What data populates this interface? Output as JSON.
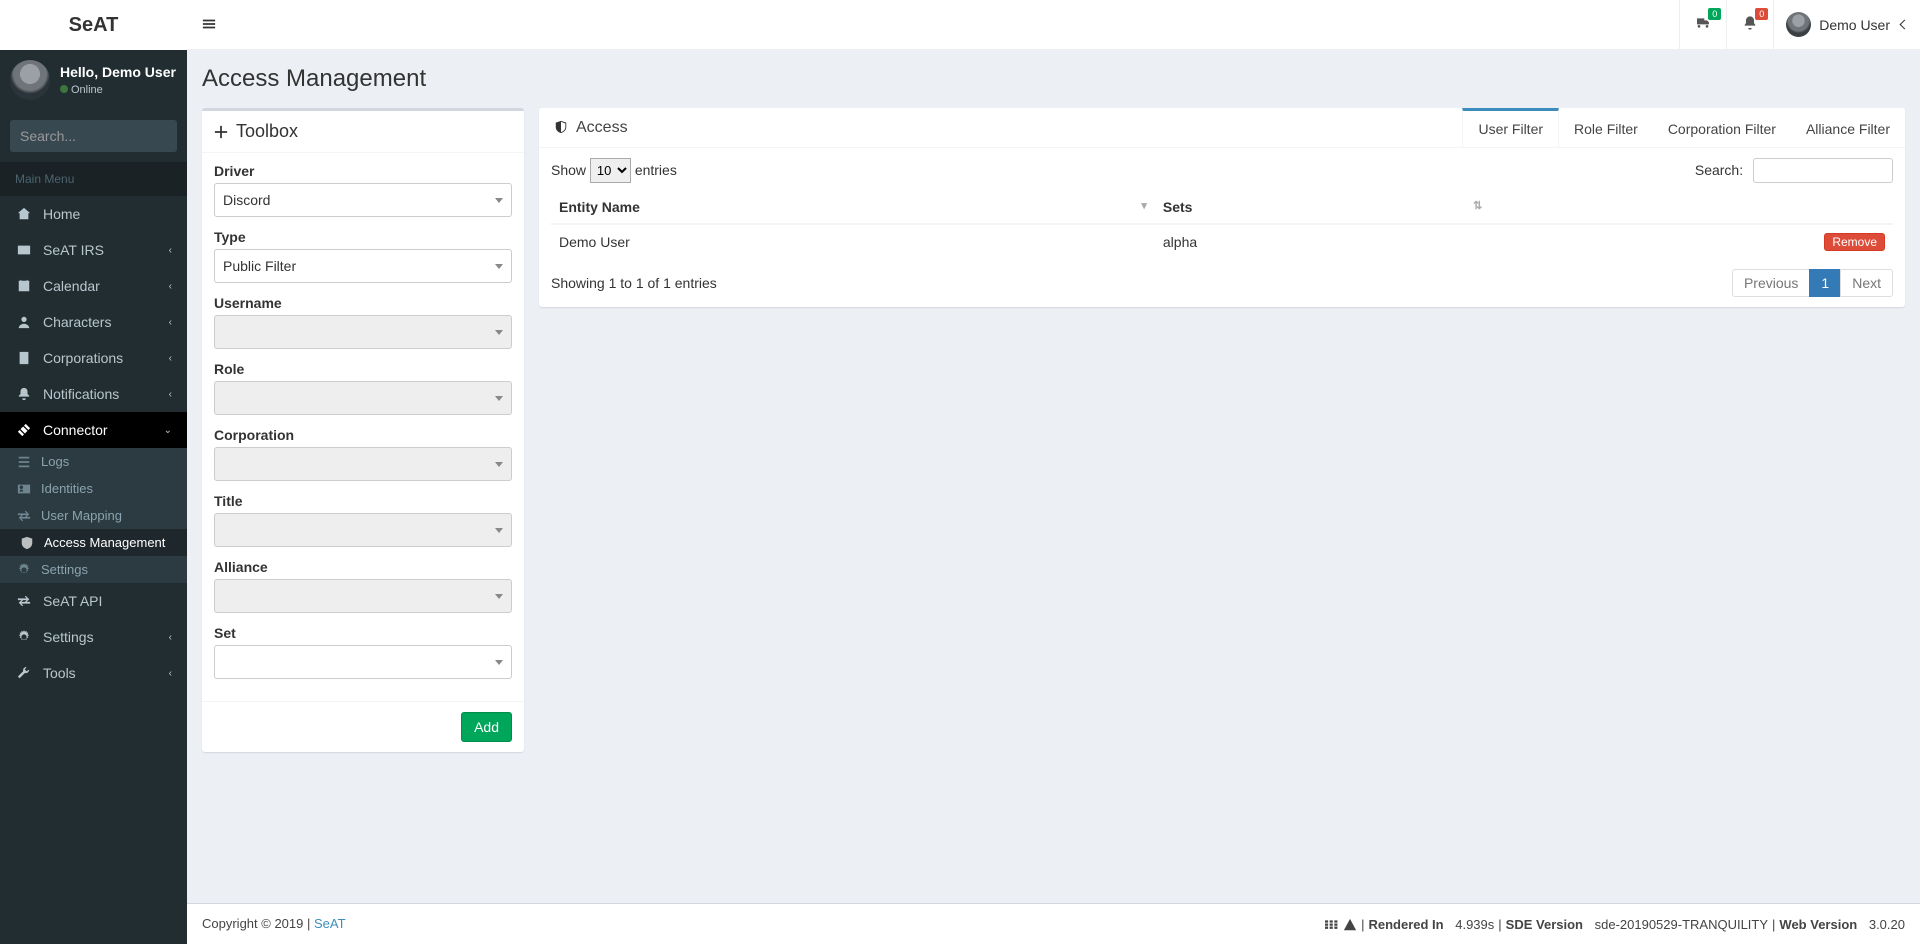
{
  "brand": {
    "bold": "Se",
    "rest": "AT"
  },
  "header": {
    "truck_badge": "0",
    "bell_badge": "0",
    "user_name": "Demo User"
  },
  "sidebar": {
    "greeting": "Hello, Demo User",
    "status": "Online",
    "search_placeholder": "Search...",
    "main_menu_label": "Main Menu",
    "items": [
      {
        "label": "Home",
        "expandable": false
      },
      {
        "label": "SeAT IRS",
        "expandable": true
      },
      {
        "label": "Calendar",
        "expandable": true
      },
      {
        "label": "Characters",
        "expandable": true
      },
      {
        "label": "Corporations",
        "expandable": true
      },
      {
        "label": "Notifications",
        "expandable": true
      },
      {
        "label": "Connector",
        "expandable": true,
        "open": true,
        "children": [
          {
            "label": "Logs"
          },
          {
            "label": "Identities"
          },
          {
            "label": "User Mapping"
          },
          {
            "label": "Access Management",
            "active": true
          },
          {
            "label": "Settings"
          }
        ]
      },
      {
        "label": "SeAT API",
        "expandable": false
      },
      {
        "label": "Settings",
        "expandable": true
      },
      {
        "label": "Tools",
        "expandable": true
      }
    ]
  },
  "page": {
    "title": "Access Management"
  },
  "toolbox": {
    "title": "Toolbox",
    "fields": {
      "driver": {
        "label": "Driver",
        "value": "Discord"
      },
      "type": {
        "label": "Type",
        "value": "Public Filter"
      },
      "username": {
        "label": "Username",
        "value": ""
      },
      "role": {
        "label": "Role",
        "value": ""
      },
      "corporation": {
        "label": "Corporation",
        "value": ""
      },
      "title": {
        "label": "Title",
        "value": ""
      },
      "alliance": {
        "label": "Alliance",
        "value": ""
      },
      "set": {
        "label": "Set",
        "value": ""
      }
    },
    "add_button": "Add"
  },
  "access": {
    "title": "Access",
    "tabs": [
      {
        "label": "User Filter",
        "active": true
      },
      {
        "label": "Role Filter"
      },
      {
        "label": "Corporation Filter"
      },
      {
        "label": "Alliance Filter"
      }
    ],
    "dt": {
      "show_label": "Show",
      "entries_label": "entries",
      "length_value": "10",
      "search_label": "Search:",
      "search_value": "",
      "columns": {
        "entity": "Entity Name",
        "sets": "Sets"
      },
      "rows": [
        {
          "entity": "Demo User",
          "sets": "alpha",
          "remove": "Remove"
        }
      ],
      "info": "Showing 1 to 1 of 1 entries",
      "prev": "Previous",
      "next": "Next",
      "page": "1"
    }
  },
  "footer": {
    "copyright": "Copyright © 2019 | ",
    "link": "SeAT",
    "render_label": "Rendered In",
    "render_value": "4.939s",
    "sde_label": "SDE Version",
    "sde_value": "sde-20190529-TRANQUILITY",
    "web_label": "Web Version",
    "web_value": "3.0.20"
  }
}
